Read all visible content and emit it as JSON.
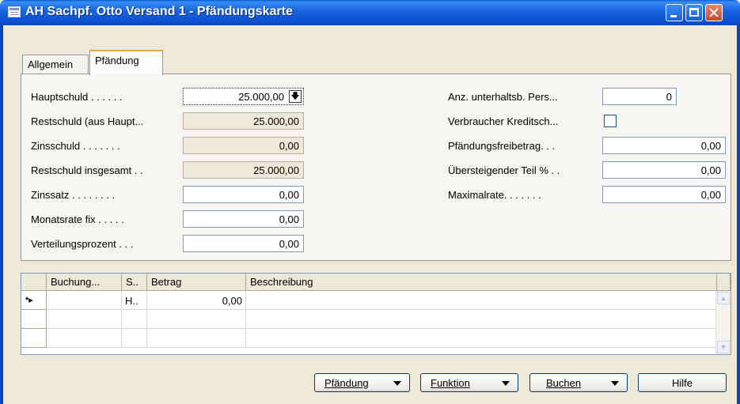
{
  "window": {
    "title": "AH Sachpf. Otto Versand 1 - Pfändungskarte",
    "icon": "form-icon"
  },
  "tabs": [
    {
      "label": "Allgemein",
      "active": false
    },
    {
      "label": "Pfändung",
      "active": true
    }
  ],
  "left_fields": {
    "hauptschuld": {
      "label": "Hauptschuld . . . . . .",
      "value": "25.000,00"
    },
    "restschuld_haupt": {
      "label": "Restschuld (aus Haupt...",
      "value": "25.000,00"
    },
    "zinsschuld": {
      "label": "Zinsschuld . . . . . . .",
      "value": "0,00"
    },
    "restschuld_gesamt": {
      "label": "Restschuld insgesamt . .",
      "value": "25.000,00"
    },
    "zinssatz": {
      "label": "Zinssatz . . . . . . . .",
      "value": "0,00"
    },
    "monatsrate": {
      "label": "Monatsrate fix . . . . .",
      "value": "0,00"
    },
    "verteilungsprozent": {
      "label": "Verteilungsprozent . . .",
      "value": "0,00"
    }
  },
  "right_fields": {
    "anz_personen": {
      "label": "Anz. unterhaltsb. Pers...",
      "value": "0"
    },
    "verbraucher_kredit": {
      "label": "Verbraucher Kreditsch...",
      "checked": false
    },
    "freibetrag": {
      "label": "Pfändungsfreibetrag. . .",
      "value": "0,00"
    },
    "uebersteigend": {
      "label": "Übersteigender Teil % . .",
      "value": "0,00"
    },
    "maximalrate": {
      "label": "Maximalrate. . . . . . .",
      "value": "0,00"
    }
  },
  "grid": {
    "columns": [
      "Buchung...",
      "S..",
      "Betrag",
      "Beschreibung"
    ],
    "rows": [
      {
        "marker": "*▸",
        "buchung": "",
        "s": "H..",
        "betrag": "0,00",
        "beschreibung": ""
      },
      {
        "marker": "",
        "buchung": "",
        "s": "",
        "betrag": "",
        "beschreibung": ""
      },
      {
        "marker": "",
        "buchung": "",
        "s": "",
        "betrag": "",
        "beschreibung": ""
      }
    ]
  },
  "buttons": {
    "pfaendung": "Pfändung",
    "funktion": "Funktion",
    "buchen": "Buchen",
    "hilfe": "Hilfe"
  }
}
